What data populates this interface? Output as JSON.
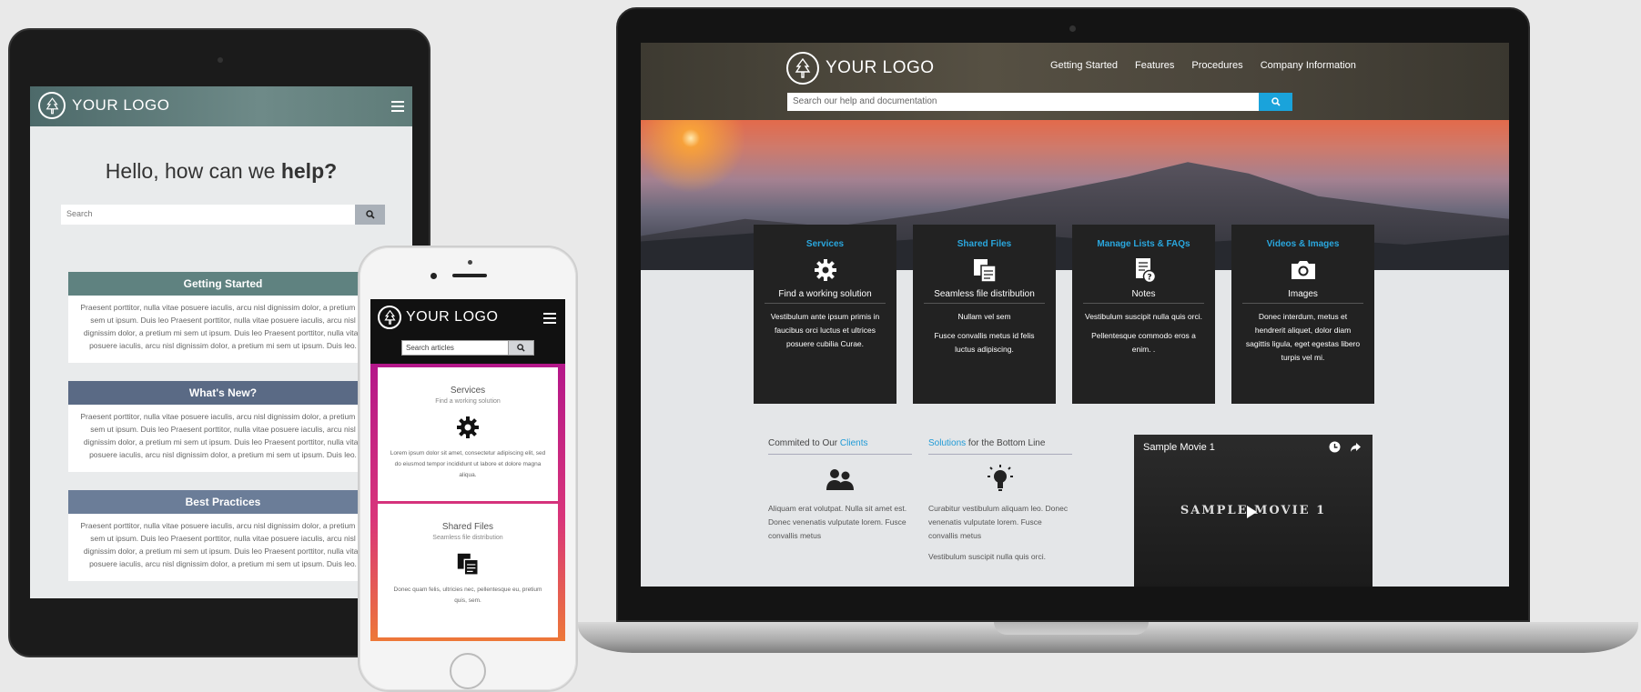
{
  "laptop": {
    "logo_text": "YOUR LOGO",
    "nav": [
      "Getting Started",
      "Features",
      "Procedures",
      "Company Information"
    ],
    "search_placeholder": "Search our help and documentation",
    "cards": [
      {
        "title": "Services",
        "icon": "gear-icon",
        "subtitle": "Find a working solution",
        "paras": [
          "Vestibulum ante ipsum primis in faucibus orci luctus et ultrices posuere cubilia Curae."
        ]
      },
      {
        "title": "Shared Files",
        "icon": "documents-icon",
        "subtitle": "Seamless file distribution",
        "paras": [
          "Nullam vel sem",
          "Fusce convallis metus id felis luctus adipiscing."
        ]
      },
      {
        "title": "Manage Lists & FAQs",
        "icon": "faq-document-icon",
        "subtitle": "Notes",
        "paras": [
          "Vestibulum suscipit nulla quis orci.",
          "Pellentesque commodo eros a enim. ."
        ]
      },
      {
        "title": "Videos & Images",
        "icon": "camera-icon",
        "subtitle": "Images",
        "paras": [
          "Donec interdum, metus et hendrerit aliquet, dolor diam sagittis ligula, eget egestas libero turpis vel mi."
        ]
      }
    ],
    "col1": {
      "heading_prefix": "Commited to Our ",
      "heading_link": "Clients",
      "icon": "users-icon",
      "paras": [
        "Aliquam erat volutpat. Nulla sit amet est. Donec venenatis vulputate lorem. Fusce convallis metus"
      ]
    },
    "col2": {
      "heading_link": "Solutions",
      "heading_suffix": " for the Bottom Line",
      "icon": "lightbulb-icon",
      "paras": [
        "Curabitur vestibulum aliquam leo. Donec venenatis vulputate lorem. Fusce convallis metus",
        "Vestibulum suscipit nulla quis orci."
      ]
    },
    "video": {
      "title": "Sample Movie 1",
      "screen_text": "SAMPLE MOVIE 1"
    }
  },
  "tablet": {
    "logo_text": "YOUR LOGO",
    "greeting_prefix": "Hello, how can we ",
    "greeting_bold": "help?",
    "search_placeholder": "Search",
    "sections": [
      {
        "title": "Getting Started",
        "color": "#5f8280",
        "body": "Praesent porttitor, nulla vitae posuere iaculis, arcu nisl dignissim dolor, a pretium mi sem ut ipsum. Duis leo Praesent porttitor, nulla vitae posuere iaculis, arcu nisl dignissim dolor, a pretium mi sem ut ipsum. Duis leo Praesent porttitor, nulla vitae posuere iaculis, arcu nisl dignissim dolor, a pretium mi sem ut ipsum. Duis leo."
      },
      {
        "title": "What's New?",
        "color": "#5a6a85",
        "body": "Praesent porttitor, nulla vitae posuere iaculis, arcu nisl dignissim dolor, a pretium mi sem ut ipsum. Duis leo Praesent porttitor, nulla vitae posuere iaculis, arcu nisl dignissim dolor, a pretium mi sem ut ipsum. Duis leo Praesent porttitor, nulla vitae posuere iaculis, arcu nisl dignissim dolor, a pretium mi sem ut ipsum. Duis leo."
      },
      {
        "title": "Best Practices",
        "color": "#6b7d98",
        "body": "Praesent porttitor, nulla vitae posuere iaculis, arcu nisl dignissim dolor, a pretium mi sem ut ipsum. Duis leo Praesent porttitor, nulla vitae posuere iaculis, arcu nisl dignissim dolor, a pretium mi sem ut ipsum. Duis leo Praesent porttitor, nulla vitae posuere iaculis, arcu nisl dignissim dolor, a pretium mi sem ut ipsum. Duis leo."
      }
    ]
  },
  "phone": {
    "logo_text": "YOUR LOGO",
    "search_placeholder": "Search articles",
    "cards": [
      {
        "title": "Services",
        "subtitle": "Find a working solution",
        "icon": "gear-icon",
        "body": "Lorem ipsum dolor sit amet, consectetur adipiscing elit, sed do eiusmod tempor incididunt ut labore et dolore magna aliqua."
      },
      {
        "title": "Shared Files",
        "subtitle": "Seamless file distribution",
        "icon": "documents-icon",
        "body": "Donec quam felis, ultricies nec, pellentesque eu, pretium quis, sem."
      }
    ]
  }
}
